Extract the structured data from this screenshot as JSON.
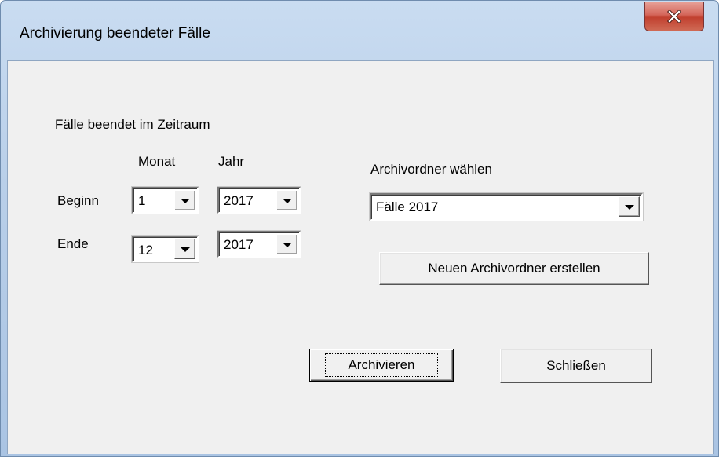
{
  "window": {
    "title": "Archivierung beendeter Fälle",
    "close_icon": "close-x-icon"
  },
  "dialog": {
    "range_heading": "Fälle beendet im Zeitraum",
    "col_month": "Monat",
    "col_year": "Jahr",
    "begin": {
      "label": "Beginn",
      "month": "1",
      "year": "2017"
    },
    "end": {
      "label": "Ende",
      "month": "12",
      "year": "2017"
    },
    "archive_folder_label": "Archivordner wählen",
    "archive_folder_value": "Fälle 2017",
    "new_folder_button": "Neuen Archivordner erstellen",
    "archive_button": "Archivieren",
    "close_button": "Schließen"
  },
  "colors": {
    "titlebar": "#c9dcf1",
    "client": "#f0f0f0",
    "close_button": "#c1402f"
  }
}
